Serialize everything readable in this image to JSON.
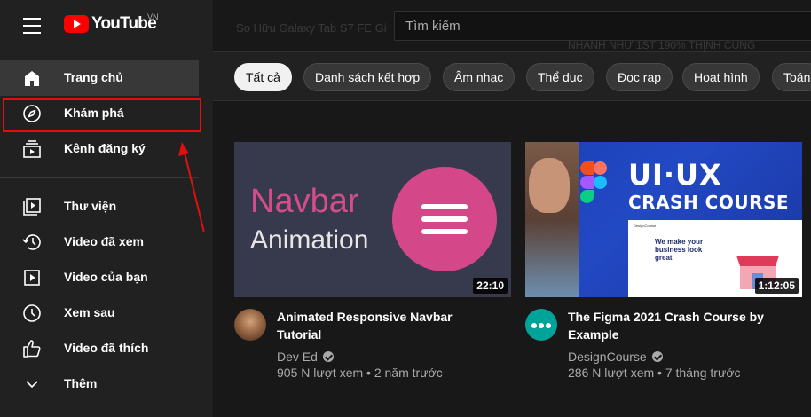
{
  "brand": {
    "logo_text": "YouTube",
    "country_code": "VN"
  },
  "header": {
    "search_placeholder": "Tìm kiếm",
    "ghost_text": "So Hữu Galaxy Tab S7 FE Gi",
    "ghost_text2": "NHANH NHƯ 1ST 190% THỊNH CUNG"
  },
  "sidebar": {
    "items": [
      {
        "label": "Trang chủ",
        "icon": "home-icon",
        "active": true
      },
      {
        "label": "Khám phá",
        "icon": "compass-icon",
        "active": false
      },
      {
        "label": "Kênh đăng ký",
        "icon": "subscriptions-icon",
        "active": false
      }
    ],
    "library": [
      {
        "label": "Thư viện",
        "icon": "library-icon"
      },
      {
        "label": "Video đã xem",
        "icon": "history-icon"
      },
      {
        "label": "Video của bạn",
        "icon": "your-videos-icon"
      },
      {
        "label": "Xem sau",
        "icon": "watch-later-icon"
      },
      {
        "label": "Video đã thích",
        "icon": "thumbs-up-icon"
      },
      {
        "label": "Thêm",
        "icon": "chevron-down-icon"
      }
    ]
  },
  "chips": [
    "Tất cả",
    "Danh sách kết hợp",
    "Âm nhạc",
    "Thể dục",
    "Đọc rap",
    "Hoạt hình",
    "Toán"
  ],
  "videos": [
    {
      "title_line1": "Animated Responsive Navbar",
      "title_line2": "Tutorial",
      "channel": "Dev Ed",
      "stats": "905 N lượt xem • 2 năm trước",
      "duration": "22:10",
      "thumb_text1": "Navbar",
      "thumb_text2": "Animation"
    },
    {
      "title_line1": "The Figma 2021 Crash Course by",
      "title_line2": "Example",
      "channel": "DesignCourse",
      "stats": "286 N lượt xem • 7 tháng trước",
      "duration": "1:12:05",
      "thumb_text1": "UI·UX",
      "thumb_text2": "CRASH COURSE",
      "mock_text": "We make your business look great",
      "mock_nav": "DesignCourse"
    }
  ],
  "colors": {
    "brand_red": "#ff0000",
    "annotation_red": "#e01010",
    "background": "#181818",
    "sidebar": "#212121"
  }
}
